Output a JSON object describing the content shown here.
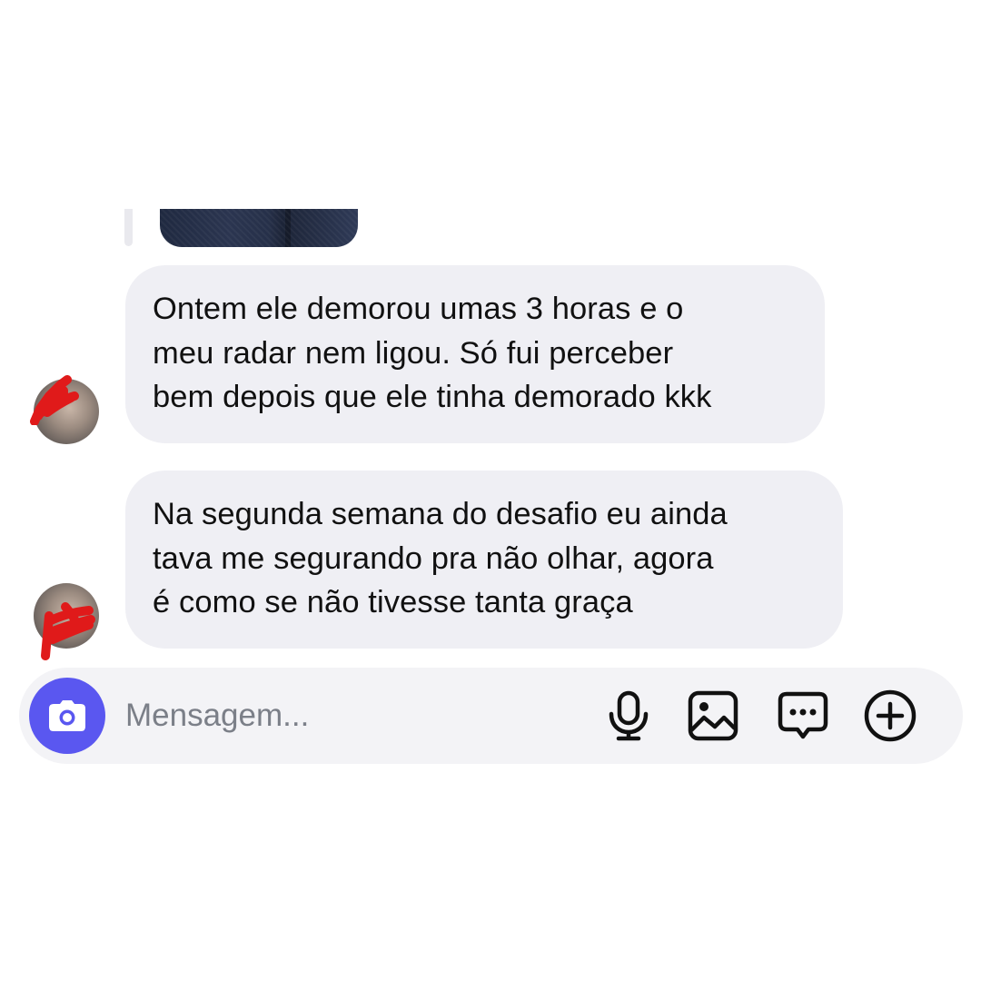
{
  "messages": [
    {
      "type": "image",
      "sender": "other"
    },
    {
      "type": "text",
      "sender": "other",
      "lines": [
        "Ontem ele demorou umas 3 horas e o",
        "meu radar nem ligou. Só fui perceber",
        "bem depois que ele tinha demorado kkk"
      ]
    },
    {
      "type": "text",
      "sender": "other",
      "lines": [
        "Na segunda semana do desafio eu ainda",
        "tava me segurando pra não olhar, agora",
        "é como se não tivesse tanta graça"
      ]
    }
  ],
  "composer": {
    "placeholder": "Mensagem...",
    "value": "",
    "icons": [
      "camera-icon",
      "microphone-icon",
      "gallery-icon",
      "sticker-icon",
      "plus-icon"
    ]
  },
  "colors": {
    "bubble_background": "#efeff4",
    "composer_background": "#f3f3f6",
    "camera_button": "#5a57f0",
    "text": "#111111",
    "placeholder": "#7b7f88",
    "redaction": "#e01a1a"
  }
}
